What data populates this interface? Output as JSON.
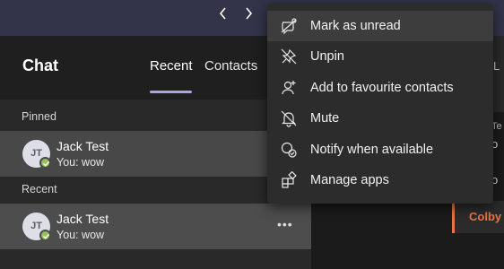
{
  "titlebar": {
    "back_icon": "chevron-left-icon",
    "forward_icon": "chevron-right-icon"
  },
  "chat": {
    "title": "Chat",
    "tabs": [
      {
        "label": "Recent",
        "selected": true
      },
      {
        "label": "Contacts",
        "selected": false
      }
    ],
    "sections": {
      "pinned_label": "Pinned",
      "recent_label": "Recent"
    },
    "pinned_row": {
      "avatar_initials": "JT",
      "name": "Jack Test",
      "preview": "You: wow",
      "presence": "available"
    },
    "recent_row": {
      "avatar_initials": "JT",
      "name": "Jack Test",
      "preview": "You: wow",
      "presence": "available",
      "more_label": "•••"
    }
  },
  "context_menu": {
    "items": [
      {
        "label": "Mark as unread",
        "icon": "mark-unread-icon"
      },
      {
        "label": "Unpin",
        "icon": "unpin-icon"
      },
      {
        "label": "Add to favourite contacts",
        "icon": "add-contact-icon"
      },
      {
        "label": "Mute",
        "icon": "mute-bell-icon"
      },
      {
        "label": "Notify when available",
        "icon": "notify-presence-icon"
      },
      {
        "label": "Manage apps",
        "icon": "apps-icon"
      }
    ]
  },
  "background_peek": {
    "text_1": "L",
    "text_2": "Te",
    "text_3": "o",
    "text_4": "o",
    "card_name": "Colby"
  },
  "colors": {
    "titlebar": "#33344a",
    "menu_bg": "#2d2c2c",
    "tab_indicator": "#a6a7dc",
    "presence_available": "#92c353",
    "accent_orange": "#e97548"
  }
}
